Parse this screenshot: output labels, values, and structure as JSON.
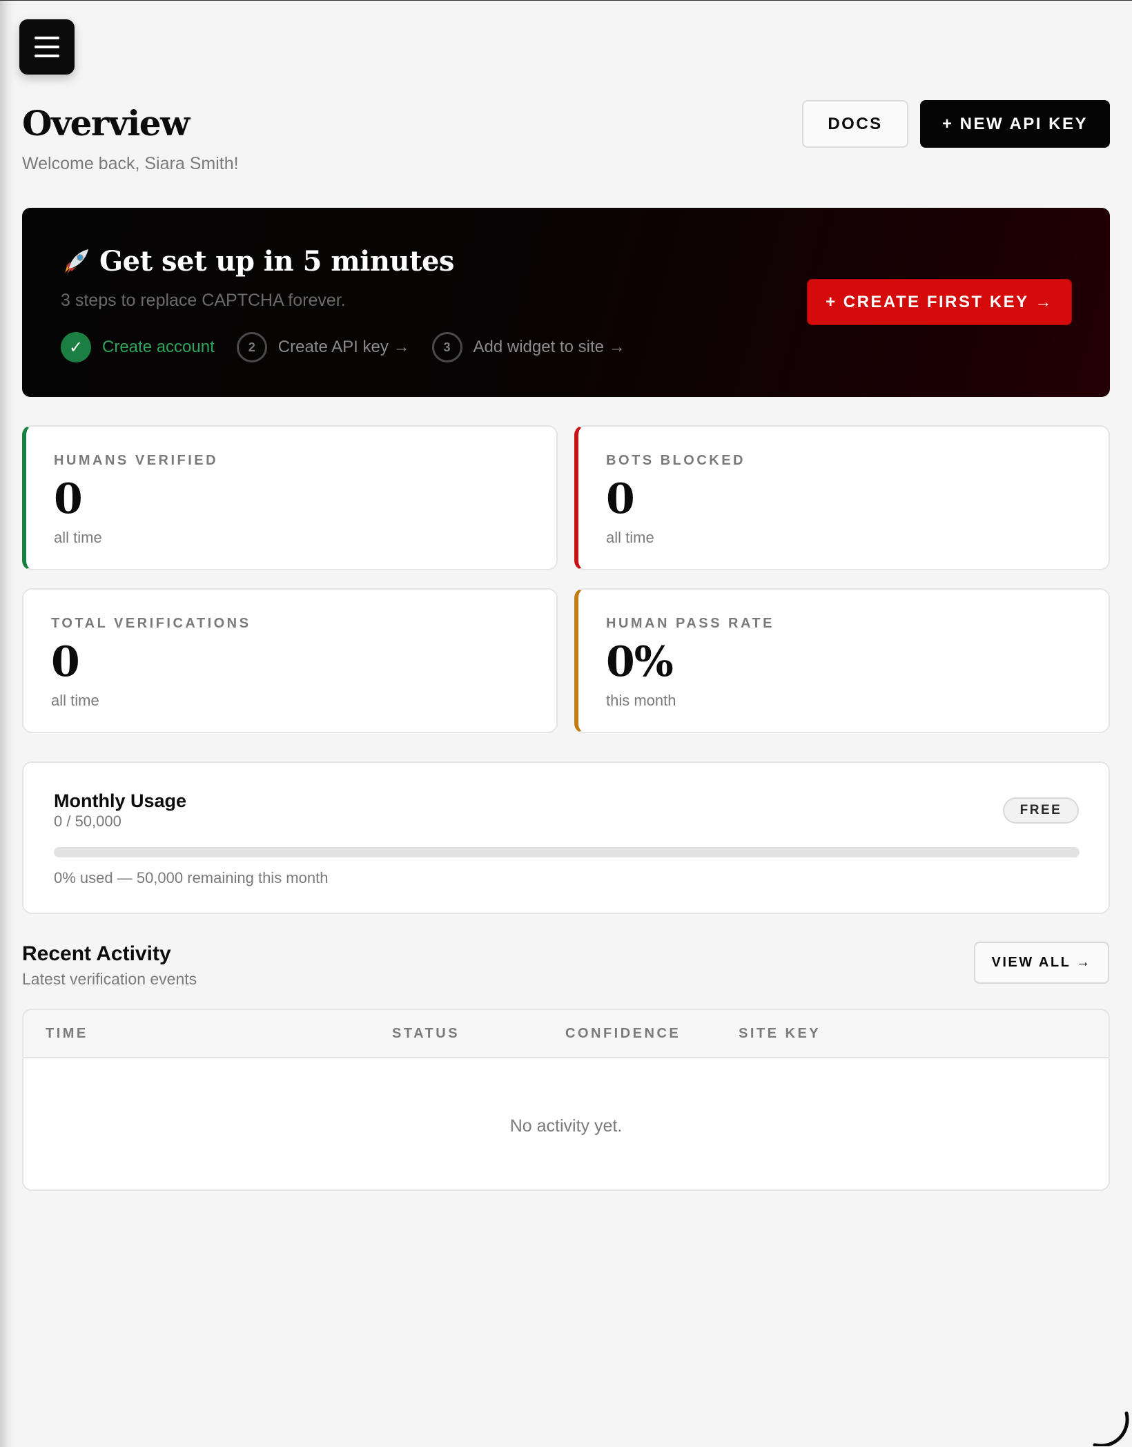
{
  "header": {
    "title": "Overview",
    "subtitle": "Welcome back, Siara Smith!",
    "docs_label": "DOCS",
    "new_key_label": "+ NEW API KEY"
  },
  "banner": {
    "icon": "rocket-icon",
    "title": "Get set up in 5 minutes",
    "subtitle": "3 steps to replace CAPTCHA forever.",
    "steps": [
      {
        "marker": "✓",
        "label": "Create account",
        "state": "done"
      },
      {
        "marker": "2",
        "label": "Create API key →",
        "state": "todo"
      },
      {
        "marker": "3",
        "label": "Add widget to site →",
        "state": "todo"
      }
    ],
    "cta_label": "+ CREATE FIRST KEY →"
  },
  "stats": [
    {
      "label": "HUMANS VERIFIED",
      "value": "0",
      "period": "all time",
      "accent": "#1a7f41"
    },
    {
      "label": "BOTS BLOCKED",
      "value": "0",
      "period": "all time",
      "accent": "#c81414"
    },
    {
      "label": "TOTAL VERIFICATIONS",
      "value": "0",
      "period": "all time",
      "accent": ""
    },
    {
      "label": "HUMAN PASS RATE",
      "value": "0%",
      "period": "this month",
      "accent": "#c07d15"
    }
  ],
  "usage": {
    "title": "Monthly Usage",
    "count": "0 / 50,000",
    "plan": "FREE",
    "percent_used": 0,
    "note": "0% used — 50,000 remaining this month"
  },
  "activity": {
    "title": "Recent Activity",
    "subtitle": "Latest verification events",
    "view_all_label": "VIEW ALL →",
    "columns": [
      "TIME",
      "STATUS",
      "CONFIDENCE",
      "SITE KEY"
    ],
    "empty_message": "No activity yet."
  },
  "colors": {
    "background": "#f5f5f5",
    "primary_dark": "#050505",
    "brand_red": "#d50b0b",
    "success_green": "#1a7f41",
    "warning_amber": "#c07d15"
  }
}
